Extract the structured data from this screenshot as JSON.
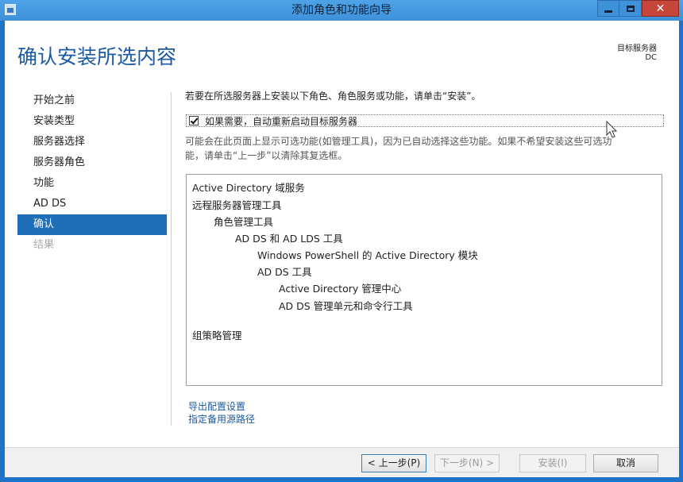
{
  "window": {
    "title": "添加角色和功能向导",
    "controls": {
      "minimize": "minimize-icon",
      "maximize": "maximize-icon",
      "close": "close-icon"
    }
  },
  "header": {
    "page_title": "确认安装所选内容",
    "target_label": "目标服务器",
    "target_value": "DC"
  },
  "nav": {
    "items": [
      {
        "label": "开始之前",
        "state": "normal"
      },
      {
        "label": "安装类型",
        "state": "normal"
      },
      {
        "label": "服务器选择",
        "state": "normal"
      },
      {
        "label": "服务器角色",
        "state": "normal"
      },
      {
        "label": "功能",
        "state": "normal"
      },
      {
        "label": "AD DS",
        "state": "normal"
      },
      {
        "label": "确认",
        "state": "selected"
      },
      {
        "label": "结果",
        "state": "disabled"
      }
    ]
  },
  "main": {
    "intro": "若要在所选服务器上安装以下角色、角色服务或功能，请单击“安装”。",
    "restart_checkbox": {
      "label": "如果需要，自动重新启动目标服务器",
      "checked": true
    },
    "note_line1": "可能会在此页面上显示可选功能(如管理工具)，因为已自动选择这些功能。如果不希望安装这些可选功",
    "note_line2": "能，请单击“上一步”以清除其复选框。",
    "features": [
      {
        "text": "Active Directory 域服务",
        "level": 0
      },
      {
        "text": "远程服务器管理工具",
        "level": 0
      },
      {
        "text": "角色管理工具",
        "level": 1
      },
      {
        "text": "AD DS 和 AD LDS 工具",
        "level": 2
      },
      {
        "text": "Windows PowerShell 的 Active Directory 模块",
        "level": 3
      },
      {
        "text": "AD DS 工具",
        "level": 3
      },
      {
        "text": "Active Directory 管理中心",
        "level": 4
      },
      {
        "text": "AD DS 管理单元和命令行工具",
        "level": 4
      },
      {
        "text": "组策略管理",
        "level": 0
      }
    ],
    "links": {
      "export": "导出配置设置",
      "alternate_source": "指定备用源路径"
    }
  },
  "footer": {
    "previous": "< 上一步(P)",
    "next": "下一步(N) >",
    "install": "安装(I)",
    "cancel": "取消"
  },
  "colors": {
    "accent": "#1f6fb8",
    "title_blue": "#1b5aa3",
    "titlebar": "#3f91da",
    "close": "#c7463a"
  }
}
